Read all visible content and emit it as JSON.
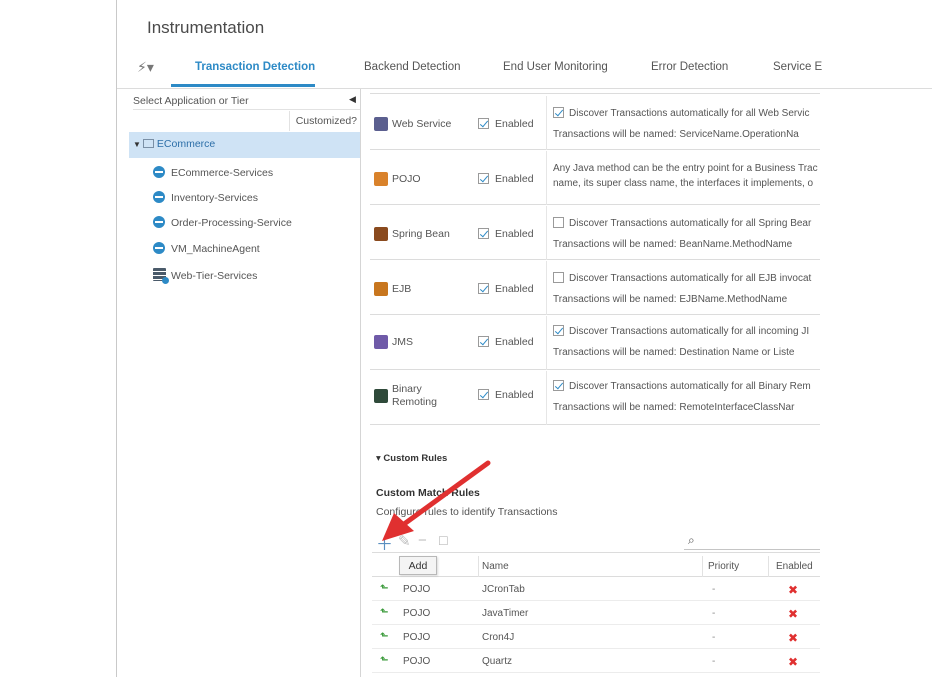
{
  "app": {
    "title": "Instrumentation"
  },
  "tabs": [
    {
      "label": "Transaction Detection",
      "active": true
    },
    {
      "label": "Backend Detection",
      "active": false
    },
    {
      "label": "End User Monitoring",
      "active": false
    },
    {
      "label": "Error Detection",
      "active": false
    },
    {
      "label": "Service E",
      "active": false
    }
  ],
  "tree": {
    "select_label": "Select Application or Tier",
    "customized_header": "Customized?",
    "root": "ECommerce",
    "items": [
      {
        "label": "ECommerce-Services",
        "icon": "node-icon"
      },
      {
        "label": "Inventory-Services",
        "icon": "node-icon"
      },
      {
        "label": "Order-Processing-Service",
        "icon": "node-icon"
      },
      {
        "label": "VM_MachineAgent",
        "icon": "node-icon"
      },
      {
        "label": "Web-Tier-Services",
        "icon": "server-icon"
      }
    ]
  },
  "detection": {
    "enabled_label": "Enabled",
    "rows": [
      {
        "name": "Web Service",
        "name2": "",
        "enabled": true,
        "auto": true,
        "line1": "Discover Transactions automatically for all Web Servic",
        "line2": "Transactions will be named: ServiceName.OperationNa",
        "icon_color": "#5b5f8f"
      },
      {
        "name": "POJO",
        "name2": "",
        "enabled": true,
        "auto": null,
        "line1": "Any Java method can be the entry point for a Business Trac",
        "line2": "name, its super class name, the interfaces it implements, o",
        "icon_color": "#d9822b"
      },
      {
        "name": "Spring Bean",
        "name2": "",
        "enabled": true,
        "auto": false,
        "line1": "Discover Transactions automatically for all Spring Bear",
        "line2": "Transactions will be named: BeanName.MethodName",
        "icon_color": "#8a4a1e"
      },
      {
        "name": "EJB",
        "name2": "",
        "enabled": true,
        "auto": false,
        "line1": "Discover Transactions automatically for all EJB invocat",
        "line2": "Transactions will be named: EJBName.MethodName",
        "icon_color": "#c8761e"
      },
      {
        "name": "JMS",
        "name2": "",
        "enabled": true,
        "auto": true,
        "line1": "Discover Transactions automatically for all incoming JI",
        "line2": "Transactions will be named: Destination Name or Liste",
        "icon_color": "#6f5aa8"
      },
      {
        "name": "Binary",
        "name2": "Remoting",
        "enabled": true,
        "auto": true,
        "line1": "Discover Transactions automatically for all Binary Rem",
        "line2": "Transactions will be named: RemoteInterfaceClassNar",
        "icon_color": "#2f4a3a"
      }
    ]
  },
  "custom_rules": {
    "header": "Custom Rules",
    "title": "Custom Match Rules",
    "subtitle": "Configure rules to identify Transactions",
    "add_tooltip": "Add",
    "columns": {
      "name": "Name",
      "priority": "Priority",
      "enabled": "Enabled"
    },
    "rows": [
      {
        "type": "POJO",
        "name": "JCronTab",
        "priority": "-",
        "enabled": false
      },
      {
        "type": "POJO",
        "name": "JavaTimer",
        "priority": "-",
        "enabled": false
      },
      {
        "type": "POJO",
        "name": "Cron4J",
        "priority": "-",
        "enabled": false
      },
      {
        "type": "POJO",
        "name": "Quartz",
        "priority": "-",
        "enabled": false
      }
    ]
  },
  "colors": {
    "accent": "#2d8ac6",
    "selection": "#cfe3f5",
    "disabled_x": "#e03030",
    "arrow": "#e03030"
  }
}
